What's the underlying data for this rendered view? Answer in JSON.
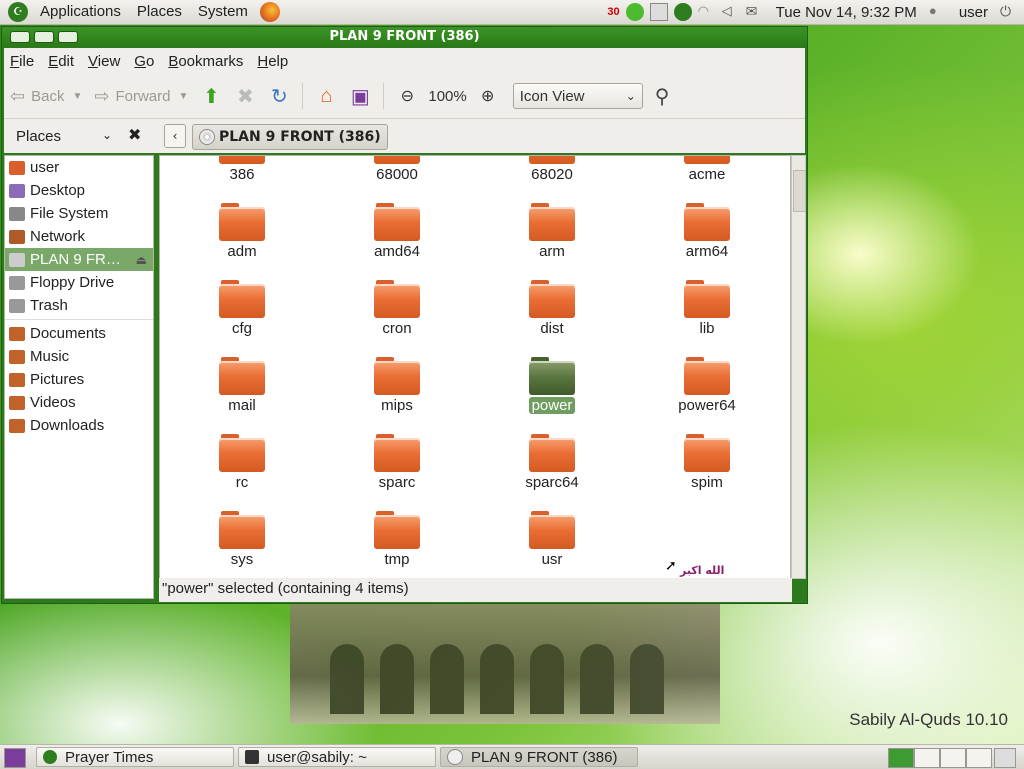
{
  "top_panel": {
    "menus": [
      "Applications",
      "Places",
      "System"
    ],
    "badge": "30",
    "clock": "Tue Nov 14,  9:32 PM",
    "user": "user"
  },
  "window": {
    "title": "PLAN 9 FRONT (386)",
    "menubar": [
      "File",
      "Edit",
      "View",
      "Go",
      "Bookmarks",
      "Help"
    ],
    "toolbar": {
      "back": "Back",
      "forward": "Forward",
      "zoom": "100%",
      "view_mode": "Icon View"
    },
    "places_label": "Places",
    "path_button": "PLAN 9 FRONT (386)",
    "sidebar": {
      "devices": [
        {
          "label": "user",
          "icon": "home-icon",
          "color": "#d9602c"
        },
        {
          "label": "Desktop",
          "icon": "desktop-icon",
          "color": "#8a6bb8"
        },
        {
          "label": "File System",
          "icon": "harddisk-icon",
          "color": "#888888"
        },
        {
          "label": "Network",
          "icon": "network-icon",
          "color": "#b05a2a"
        },
        {
          "label": "PLAN 9 FR…",
          "icon": "cdrom-icon",
          "color": "#cccccc",
          "selected": true
        },
        {
          "label": "Floppy Drive",
          "icon": "floppy-icon",
          "color": "#999999"
        },
        {
          "label": "Trash",
          "icon": "trash-icon",
          "color": "#999999"
        }
      ],
      "bookmarks": [
        {
          "label": "Documents",
          "icon": "documents-folder-icon",
          "color": "#c0622a"
        },
        {
          "label": "Music",
          "icon": "music-folder-icon",
          "color": "#c0622a"
        },
        {
          "label": "Pictures",
          "icon": "pictures-folder-icon",
          "color": "#c0622a"
        },
        {
          "label": "Videos",
          "icon": "videos-folder-icon",
          "color": "#c0622a"
        },
        {
          "label": "Downloads",
          "icon": "downloads-folder-icon",
          "color": "#c0622a"
        }
      ]
    },
    "files": [
      {
        "name": "386"
      },
      {
        "name": "68000"
      },
      {
        "name": "68020"
      },
      {
        "name": "acme"
      },
      {
        "name": "adm"
      },
      {
        "name": "amd64"
      },
      {
        "name": "arm"
      },
      {
        "name": "arm64"
      },
      {
        "name": "cfg"
      },
      {
        "name": "cron"
      },
      {
        "name": "dist"
      },
      {
        "name": "lib"
      },
      {
        "name": "mail"
      },
      {
        "name": "mips"
      },
      {
        "name": "power",
        "selected": true
      },
      {
        "name": "power64"
      },
      {
        "name": "rc"
      },
      {
        "name": "sparc"
      },
      {
        "name": "sparc64"
      },
      {
        "name": "spim"
      },
      {
        "name": "sys"
      },
      {
        "name": "tmp"
      },
      {
        "name": "usr"
      }
    ],
    "status": "\"power\" selected (containing 4 items)"
  },
  "desktop": {
    "brand": "Sabily Al-Quds 10.10",
    "arabic": "الله اكبر"
  },
  "taskbar": {
    "tasks": [
      "Prayer Times",
      "user@sabily: ~",
      "PLAN 9 FRONT (386)"
    ]
  }
}
